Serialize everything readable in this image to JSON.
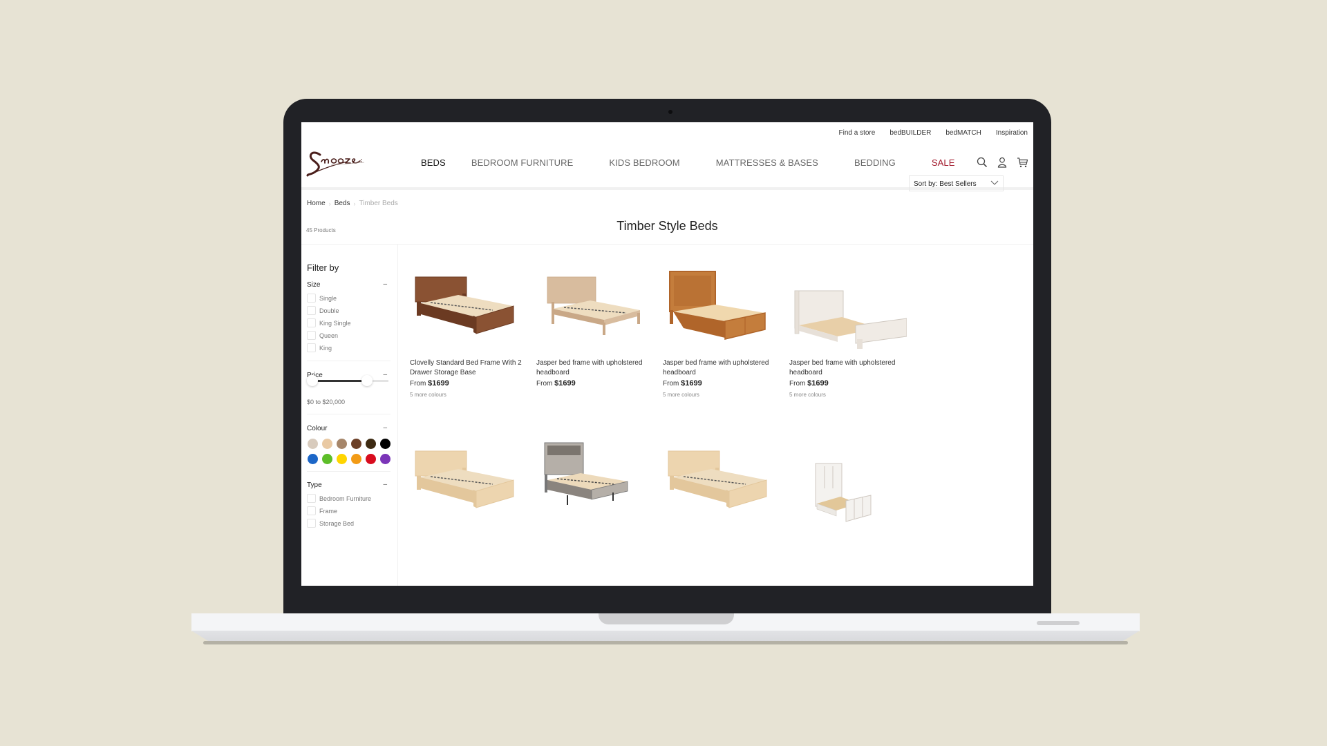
{
  "colors": {
    "background": "#E7E3D4",
    "bezel": "#212226",
    "sale": "#A1172A",
    "logo": "#4A1E1B"
  },
  "utility_nav": [
    "Find a store",
    "bedBUILDER",
    "bedMATCH",
    "Inspiration"
  ],
  "logo_text": "Snooze",
  "main_nav": {
    "items": [
      "BEDS",
      "BEDROOM FURNITURE",
      "KIDS BEDROOM",
      "MATTRESSES & BASES",
      "BEDDING"
    ],
    "sale": "SALE"
  },
  "header_icons": [
    "search-icon",
    "user-icon",
    "cart-icon"
  ],
  "breadcrumb": [
    "Home",
    "Beds",
    "Timber Beds"
  ],
  "product_count": "45 Products",
  "page_title": "Timber Style Beds",
  "sort": {
    "label": "Sort by: Best Sellers"
  },
  "filters": {
    "title": "Filter by",
    "size": {
      "label": "Size",
      "options": [
        "Single",
        "Double",
        "King Single",
        "Queen",
        "King"
      ]
    },
    "price": {
      "label": "Price",
      "min_value": 0,
      "max_value": 20000,
      "low_fraction": 0.0,
      "high_fraction": 0.72,
      "range_label": "$0 to $20,000"
    },
    "colour": {
      "label": "Colour",
      "swatches": [
        "#D8CBBD",
        "#E9C9A3",
        "#A6866A",
        "#6B3F26",
        "#3D2A12",
        "#000000",
        "#1C66C7",
        "#5DBE29",
        "#FFD500",
        "#F29B16",
        "#D80C1E",
        "#7B35B8"
      ]
    },
    "type": {
      "label": "Type",
      "options": [
        "Bedroom Furniture",
        "Frame",
        "Storage Bed"
      ]
    },
    "collapse_symbol": "–"
  },
  "products": [
    {
      "name": "Clovelly Standard Bed Frame With 2 Drawer Storage Base",
      "price_prefix": "From",
      "price": "$1699",
      "more_colours": "5 more colours",
      "wood": "#6B3A22",
      "wood_light": "#8A5233",
      "style": "dark"
    },
    {
      "name": "Jasper bed frame with upholstered headboard",
      "price_prefix": "From",
      "price": "$1699",
      "more_colours": "",
      "wood": "#C9A887",
      "wood_light": "#D8BC9E",
      "style": "legs"
    },
    {
      "name": "Jasper bed frame with upholstered headboard",
      "price_prefix": "From",
      "price": "$1699",
      "more_colours": "5 more colours",
      "wood": "#B0652A",
      "wood_light": "#C47D3C",
      "style": "storage"
    },
    {
      "name": "Jasper bed frame with upholstered headboard",
      "price_prefix": "From",
      "price": "$1699",
      "more_colours": "5 more colours",
      "wood": "#E7E0D8",
      "wood_light": "#F0EBE5",
      "style": "white"
    },
    {
      "name": "",
      "price_prefix": "",
      "price": "",
      "more_colours": "",
      "wood": "#E3C79C",
      "wood_light": "#EDD5AF",
      "style": "light"
    },
    {
      "name": "",
      "price_prefix": "",
      "price": "",
      "more_colours": "",
      "wood": "#9C958E",
      "wood_light": "#B5AFA8",
      "style": "grey"
    },
    {
      "name": "",
      "price_prefix": "",
      "price": "",
      "more_colours": "",
      "wood": "#E3C79C",
      "wood_light": "#EDD5AF",
      "style": "light"
    },
    {
      "name": "",
      "price_prefix": "",
      "price": "",
      "more_colours": "",
      "wood": "#ECE9E4",
      "wood_light": "#F4F2EF",
      "style": "shutter"
    }
  ]
}
